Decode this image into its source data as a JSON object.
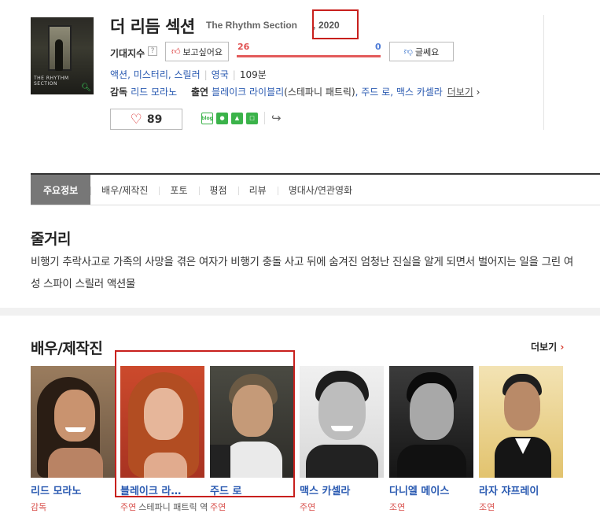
{
  "movie": {
    "title_kr": "더 리듬 섹션",
    "title_en": "The Rhythm Section",
    "year_sep": ",",
    "year": "2020"
  },
  "expect": {
    "label": "기대지수",
    "help": "?",
    "want_label": "보고싶어요",
    "want_count": "26",
    "hate_label": "글쎄요",
    "hate_count": "0",
    "want_ratio": 1.0
  },
  "info": {
    "genres": "액션, 미스터리, 스릴러",
    "country": "영국",
    "runtime": "109분"
  },
  "credits": {
    "director_label": "감독",
    "director": "리드 모라노",
    "cast_label": "출연",
    "lead_actor": "블레이크 라이블리",
    "lead_role": "(스테파니 패트릭)",
    "others": ", 주드 로, 맥스 카셀라",
    "more": "더보기",
    "more_arrow": "›"
  },
  "likes": {
    "count": "89",
    "icon": "heart-icon"
  },
  "share": {
    "blog": "blog"
  },
  "tabs": [
    "주요정보",
    "배우/제작진",
    "포토",
    "평점",
    "리뷰",
    "명대사/연관영화"
  ],
  "synopsis": {
    "title": "줄거리",
    "text": "비행기 추락사고로 가족의 사망을 겪은 여자가 비행기 충돌 사고 뒤에 숨겨진 엄청난 진실을 알게 되면서 벌어지는 일을 그린 여성 스파이 스릴러 액션물"
  },
  "cast": {
    "title": "배우/제작진",
    "more": "더보기",
    "more_arrow": "›",
    "people": [
      {
        "name": "리드 모라노",
        "role": "감독",
        "character": ""
      },
      {
        "name": "블레이크 라…",
        "role": "주연",
        "character": "스테파니 패트릭 역"
      },
      {
        "name": "주드 로",
        "role": "주연",
        "character": ""
      },
      {
        "name": "맥스 카셀라",
        "role": "주연",
        "character": ""
      },
      {
        "name": "다니엘 메이스",
        "role": "조연",
        "character": ""
      },
      {
        "name": "라자 쟈프레이",
        "role": "조연",
        "character": ""
      }
    ]
  },
  "colors": {
    "link": "#2a5ab1",
    "accent_red": "#c8201d",
    "want_red": "#e35b5b",
    "hate_blue": "#4d7ad6",
    "tab_active": "#777777"
  }
}
